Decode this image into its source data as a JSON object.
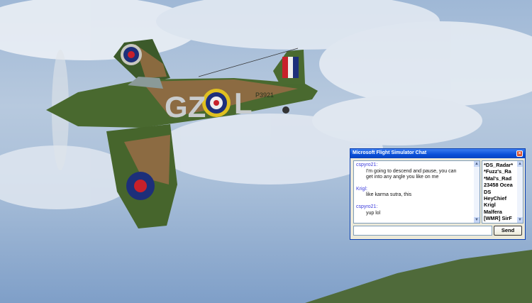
{
  "aircraft": {
    "codes_left": "GZ",
    "codes_right": "L",
    "serial": "P3921"
  },
  "chat": {
    "title": "Microsoft Flight Simulator Chat",
    "close_icon": "close-icon",
    "messages": [
      {
        "sender": "cspyro21:",
        "lines": [
          "I'm going to descend and pause, you can",
          "get into any angle you like on me"
        ]
      },
      {
        "sender": "Krigl:",
        "lines": [
          "like karma sutra, this"
        ]
      },
      {
        "sender": "cspyro21:",
        "lines": [
          "yup lol"
        ]
      }
    ],
    "users": [
      "*DS_Radar*",
      "*Fuzz's_Ra",
      "*Mal's_Rad",
      "23458 Ocea",
      "DS",
      "HeyChief",
      "Krigl",
      "Malfera",
      "[WMR] SirF"
    ],
    "input_value": "",
    "send_label": "Send"
  }
}
